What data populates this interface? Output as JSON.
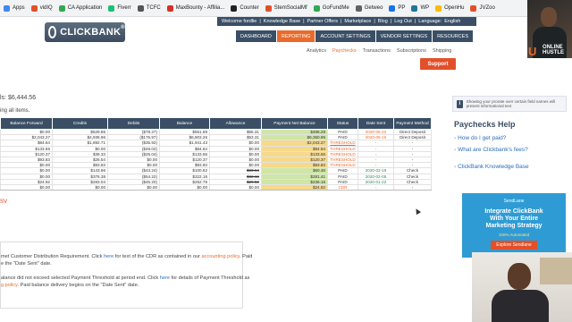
{
  "bookmarks": [
    {
      "label": "Apps",
      "color": "#4285f4"
    },
    {
      "label": "vidIQ",
      "color": "#e2502a"
    },
    {
      "label": "CA Application",
      "color": "#34a853"
    },
    {
      "label": "Fiverr",
      "color": "#1dbf73"
    },
    {
      "label": "TCFC",
      "color": "#555555"
    },
    {
      "label": "MaxBounty - Affilia...",
      "color": "#d93025"
    },
    {
      "label": "Counter",
      "color": "#202124"
    },
    {
      "label": "StemSocialMf",
      "color": "#e2502a"
    },
    {
      "label": "GoFundMe",
      "color": "#34a853"
    },
    {
      "label": "Getweo",
      "color": "#5f6368"
    },
    {
      "label": "PP",
      "color": "#1a73e8"
    },
    {
      "label": "WP",
      "color": "#21759b"
    },
    {
      "label": "OpenHu",
      "color": "#fbbc04"
    },
    {
      "label": "JVZoo",
      "color": "#e2502a"
    }
  ],
  "topnav": [
    "Welcome fordlie",
    "|",
    "Knowledge Base",
    "|",
    "Partner Offers",
    "|",
    "Marketplace",
    "|",
    "Blog",
    "|",
    "Log Out",
    "|",
    "Language:",
    "English"
  ],
  "logo": "CLICKBANK",
  "logo_tm": "®",
  "mainnav": [
    {
      "label": "DASHBOARD",
      "active": false
    },
    {
      "label": "REPORTING",
      "active": true
    },
    {
      "label": "ACCOUNT SETTINGS",
      "active": false
    },
    {
      "label": "VENDOR SETTINGS",
      "active": false
    },
    {
      "label": "RESOURCES",
      "active": false
    }
  ],
  "subnav": [
    {
      "label": "Analytics",
      "active": false
    },
    {
      "label": "Paychecks",
      "active": true
    },
    {
      "label": "Transactions",
      "active": false
    },
    {
      "label": "Subscriptions",
      "active": false
    },
    {
      "label": "Shipping",
      "active": false
    }
  ],
  "support_label": "Support",
  "webcam_brand": {
    "initial": "U",
    "line1": "ONLINE",
    "line2": "HUSTLE"
  },
  "balance_text": "ls:  $6,444.56",
  "showing_text": "ing all items.",
  "table": {
    "headers": [
      "Balance Forward",
      "Credits",
      "Debits",
      "Balance",
      "Allowance",
      "Payment Net Balance",
      "Status",
      "Date Sent",
      "Payment Method"
    ],
    "rows": [
      [
        "$0.00",
        "$629.86",
        "($78.27)",
        "$551.59",
        "$55.31",
        "$496.28",
        "PAID",
        "2020-05-22",
        "Direct Deposit"
      ],
      [
        "$2,043.27",
        "$4,936.96",
        "($176.97)",
        "$6,803.26",
        "$53.31",
        "$6,350.95",
        "PAID",
        "2020-05-15",
        "Direct Deposit"
      ],
      [
        "$84.64",
        "$1,892.71",
        "($35.92)",
        "$1,941.43",
        "$0.00",
        "$2,043.27",
        "THRESHOLD",
        "-",
        "-"
      ],
      [
        "$133.66",
        "$0.00",
        "($49.02)",
        "$84.64",
        "$0.00",
        "$84.64",
        "THRESHOLD",
        "-",
        "-"
      ],
      [
        "$120.37",
        "$38.33",
        "($25.04)",
        "$133.66",
        "$0.00",
        "$133.66",
        "THRESHOLD",
        "-",
        "-"
      ],
      [
        "$93.83",
        "$26.54",
        "$0.00",
        "$120.37",
        "$0.00",
        "$120.37",
        "THRESHOLD",
        "-",
        "-"
      ],
      [
        "$0.00",
        "$93.83",
        "$0.00",
        "$93.83",
        "$0.00",
        "$93.83",
        "THRESHOLD",
        "-",
        "-"
      ],
      [
        "$0.00",
        "$143.86",
        "($43.24)",
        "$100.62",
        "$33.64",
        "$60.48",
        "PAID",
        "2020-02-19",
        "Check"
      ],
      [
        "$0.00",
        "$376.38",
        "($54.22)",
        "$322.16",
        "$32.16",
        "$281.41",
        "PAID",
        "2020-02-05",
        "Check"
      ],
      [
        "$24.92",
        "$283.04",
        "($45.20)",
        "$262.76",
        "$26.52",
        "$236.16",
        "PAID",
        "2020-01-22",
        "Check"
      ],
      [
        "$0.00",
        "$0.00",
        "$0.00",
        "$0.00",
        "$0.00",
        "$24.92",
        "CDR",
        "-",
        "-"
      ]
    ],
    "date_colors": [
      "orange",
      "orange",
      "",
      "",
      "",
      "",
      "",
      "green",
      "green",
      "green",
      ""
    ],
    "allowance_strike": [
      false,
      false,
      false,
      false,
      false,
      false,
      false,
      true,
      true,
      true,
      false
    ]
  },
  "csv_link": "SV",
  "notes": [
    {
      "parts": [
        {
          "t": "met Customer Distribution Requirement. Click ",
          "k": ""
        },
        {
          "t": "here",
          "k": "lnk"
        },
        {
          "t": " for text of the CDR as contained in our ",
          "k": ""
        },
        {
          "t": "accounting policy",
          "k": "red"
        },
        {
          "t": ". Paid",
          "k": ""
        }
      ]
    },
    {
      "parts": [
        {
          "t": "e the \"Date Sent\" date.",
          "k": ""
        }
      ]
    },
    {
      "parts": [
        {
          "t": "",
          "k": ""
        }
      ]
    },
    {
      "parts": [
        {
          "t": "alance did not exceed selected Payment Threshold at period end. Click ",
          "k": ""
        },
        {
          "t": "here",
          "k": "lnk"
        },
        {
          "t": " for details of Payment Threshold as",
          "k": ""
        }
      ]
    },
    {
      "parts": [
        {
          "t": "g policy",
          "k": "red"
        },
        {
          "t": ". Paid balance delivery begins on the \"Date Sent\" date.",
          "k": ""
        }
      ]
    }
  ],
  "info_text": "Showing your prorate over certain field names will present informational text",
  "help": {
    "title": "Paychecks Help",
    "items": [
      "How do I get paid?",
      "What are Clickbank's fees?",
      "ClickBank Knowledge Base"
    ]
  },
  "ad": {
    "brand": "SendLane",
    "title_line1": "Integrate ClickBank",
    "title_line2": "With Your Entire",
    "title_line3": "Marketing Strategy",
    "sub": "100% Automated",
    "button": "Explore Sendlane"
  }
}
